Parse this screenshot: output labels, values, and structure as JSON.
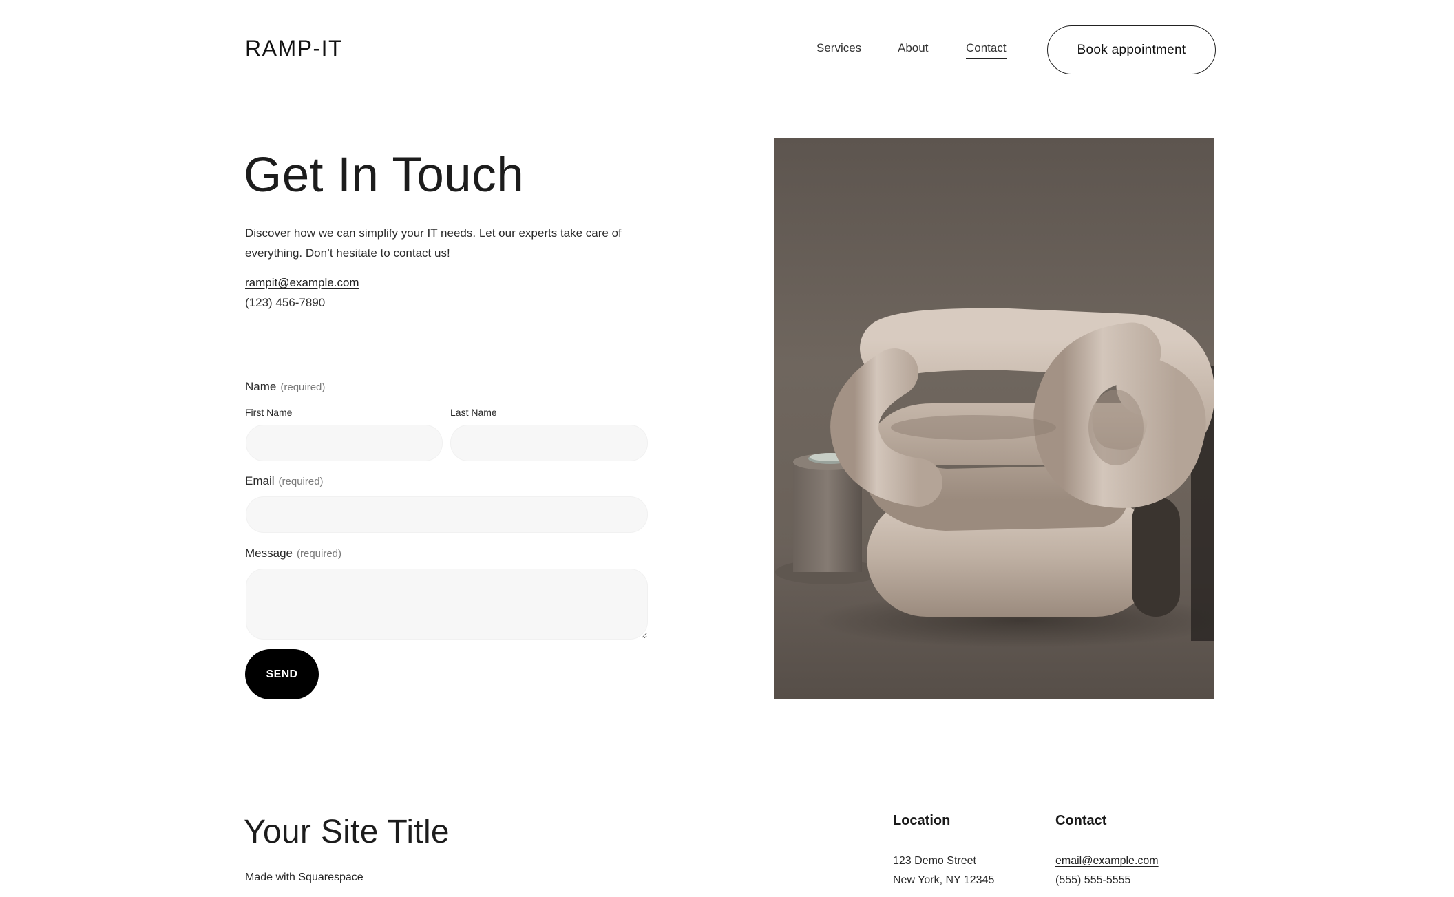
{
  "header": {
    "logo": "RAMP-IT",
    "nav": [
      "Services",
      "About",
      "Contact"
    ],
    "active_nav": "Contact",
    "book_button": "Book appointment"
  },
  "hero": {
    "title": "Get In Touch",
    "intro": "Discover how we can simplify your IT needs. Let our experts take care of everything. Don’t hesitate to contact us!",
    "email": "rampit@example.com",
    "phone": "(123) 456-7890"
  },
  "form": {
    "name_label": "Name",
    "required_text": "(required)",
    "first_name_label": "First Name",
    "last_name_label": "Last Name",
    "first_name_value": "",
    "last_name_value": "",
    "email_label": "Email",
    "email_value": "",
    "message_label": "Message",
    "message_value": "",
    "send_button": "SEND"
  },
  "image": {
    "subject": "sculptural beige tube armchair with stone side table",
    "wall_color": "#6f665e",
    "chair_color": "#c7b8ab"
  },
  "footer": {
    "site_title": "Your Site Title",
    "made_with_prefix": "Made with",
    "made_with_link": "Squarespace",
    "location_heading": "Location",
    "address_line1": "123 Demo Street",
    "address_line2": "New York, NY 12345",
    "contact_heading": "Contact",
    "contact_email": "email@example.com",
    "contact_phone": "(555) 555-5555"
  }
}
